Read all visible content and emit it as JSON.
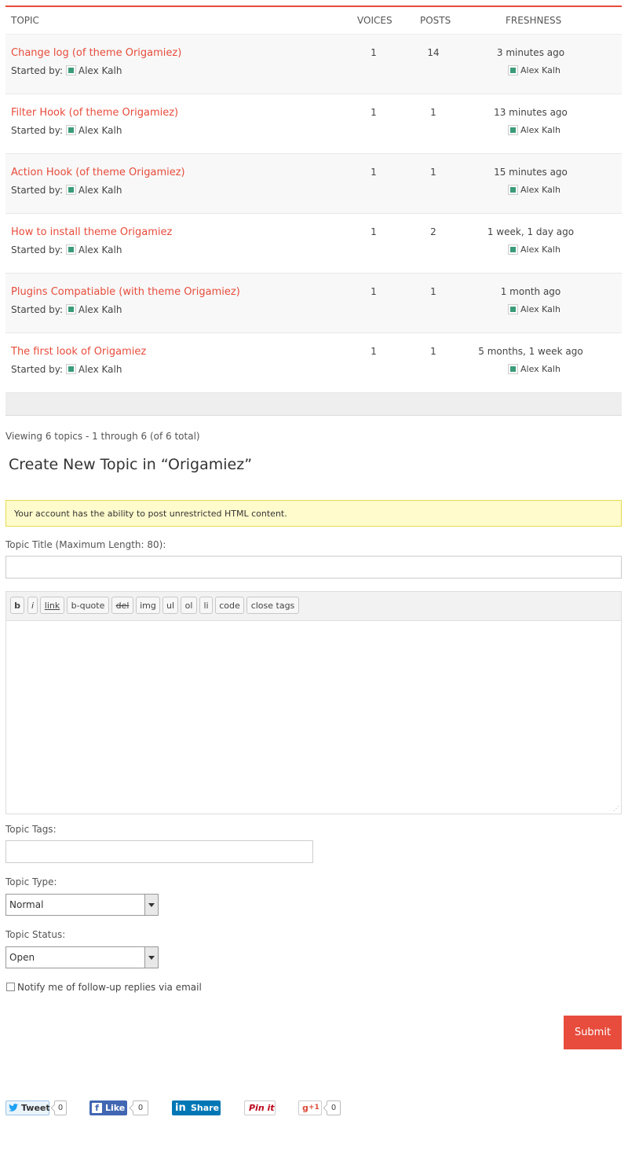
{
  "table": {
    "headers": {
      "topic": "TOPIC",
      "voices": "VOICES",
      "posts": "POSTS",
      "freshness": "FRESHNESS"
    },
    "started_by_label": "Started by:",
    "rows": [
      {
        "title": "Change log (of theme Origamiez)",
        "author": "Alex Kalh",
        "voices": "1",
        "posts": "14",
        "freshness": "3 minutes ago",
        "fresh_author": "Alex Kalh"
      },
      {
        "title": "Filter Hook (of theme Origamiez)",
        "author": "Alex Kalh",
        "voices": "1",
        "posts": "1",
        "freshness": "13 minutes ago",
        "fresh_author": "Alex Kalh"
      },
      {
        "title": "Action Hook (of theme Origamiez)",
        "author": "Alex Kalh",
        "voices": "1",
        "posts": "1",
        "freshness": "15 minutes ago",
        "fresh_author": "Alex Kalh"
      },
      {
        "title": "How to install theme Origamiez",
        "author": "Alex Kalh",
        "voices": "1",
        "posts": "2",
        "freshness": "1 week, 1 day ago",
        "fresh_author": "Alex Kalh"
      },
      {
        "title": "Plugins Compatiable (with theme Origamiez)",
        "author": "Alex Kalh",
        "voices": "1",
        "posts": "1",
        "freshness": "1 month ago",
        "fresh_author": "Alex Kalh"
      },
      {
        "title": "The first look of Origamiez",
        "author": "Alex Kalh",
        "voices": "1",
        "posts": "1",
        "freshness": "5 months, 1 week ago",
        "fresh_author": "Alex Kalh"
      }
    ]
  },
  "viewing": "Viewing 6 topics - 1 through 6 (of 6 total)",
  "form": {
    "title": "Create New Topic in “Origamiez”",
    "notice": "Your account has the ability to post unrestricted HTML content.",
    "topic_title_label": "Topic Title (Maximum Length: 80):",
    "topic_title_value": "",
    "toolbar": [
      "b",
      "i",
      "link",
      "b-quote",
      "del",
      "img",
      "ul",
      "ol",
      "li",
      "code",
      "close tags"
    ],
    "tags_label": "Topic Tags:",
    "type_label": "Topic Type:",
    "type_value": "Normal",
    "status_label": "Topic Status:",
    "status_value": "Open",
    "notify_label": "Notify me of follow-up replies via email",
    "submit_label": "Submit"
  },
  "social": {
    "tweet": "Tweet",
    "tweet_count": "0",
    "like": "Like",
    "like_count": "0",
    "share": "Share",
    "pinit": "Pin it",
    "gplus": "+1",
    "gplus_count": "0"
  },
  "colors": {
    "accent": "#e74c3c",
    "notice_bg": "#fffbcc",
    "avatar": "#3a9c78"
  }
}
